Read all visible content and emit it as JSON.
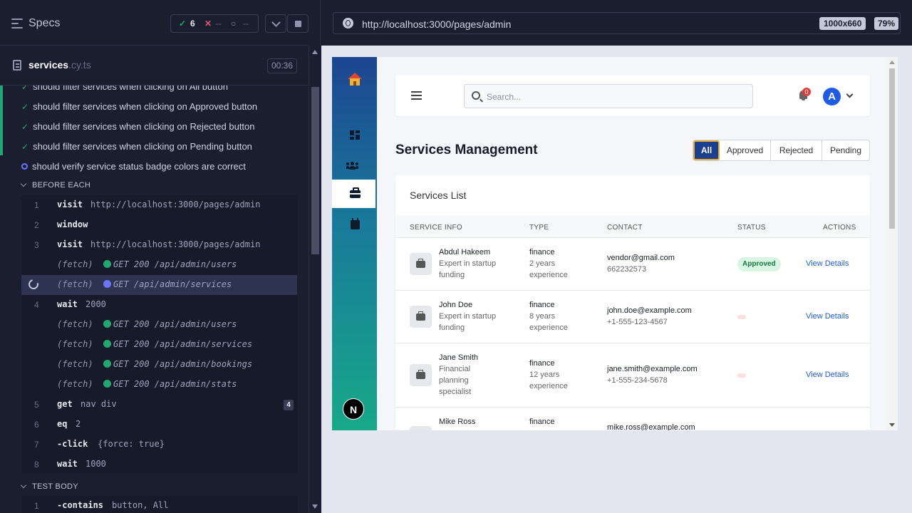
{
  "reporter": {
    "specs_label": "Specs",
    "stats": {
      "passed": "6",
      "failed": "--",
      "pending": "--"
    },
    "spec": {
      "name": "services",
      "ext": ".cy.ts",
      "duration": "00:36"
    },
    "tests": [
      {
        "title": "should filter services when clicking on All button",
        "state": "passed"
      },
      {
        "title": "should filter services when clicking on Approved button",
        "state": "passed"
      },
      {
        "title": "should filter services when clicking on Rejected button",
        "state": "passed"
      },
      {
        "title": "should filter services when clicking on Pending button",
        "state": "passed"
      },
      {
        "title": "should verify service status badge colors are correct",
        "state": "running"
      }
    ],
    "before_each_label": "BEFORE EACH",
    "before_each": [
      {
        "num": "1",
        "name": "visit",
        "msg": "http://localhost:3000/pages/admin"
      },
      {
        "num": "2",
        "name": "window",
        "msg": ""
      },
      {
        "num": "3",
        "name": "visit",
        "msg": "http://localhost:3000/pages/admin"
      },
      {
        "num": "",
        "name": "(fetch)",
        "msg": "GET 200 /api/admin/users"
      },
      {
        "num": "",
        "name": "(fetch)",
        "msg": "GET /api/admin/services"
      },
      {
        "num": "4",
        "name": "wait",
        "msg": "2000"
      },
      {
        "num": "",
        "name": "(fetch)",
        "msg": "GET 200 /api/admin/users"
      },
      {
        "num": "",
        "name": "(fetch)",
        "msg": "GET 200 /api/admin/services"
      },
      {
        "num": "",
        "name": "(fetch)",
        "msg": "GET 200 /api/admin/bookings"
      },
      {
        "num": "",
        "name": "(fetch)",
        "msg": "GET 200 /api/admin/stats"
      },
      {
        "num": "5",
        "name": "get",
        "msg": "nav div",
        "badge": "4"
      },
      {
        "num": "6",
        "name": "eq",
        "msg": "2"
      },
      {
        "num": "7",
        "name": "-click",
        "msg": "{force: true}"
      },
      {
        "num": "8",
        "name": "wait",
        "msg": "1000"
      }
    ],
    "test_body_label": "TEST BODY",
    "test_body": [
      {
        "num": "1",
        "name": "-contains",
        "msg": "button, All"
      }
    ]
  },
  "browser": {
    "url": "http://localhost:3000/pages/admin",
    "viewport": "1000x660",
    "zoom": "79%"
  },
  "app": {
    "logo_letter": "N",
    "search_placeholder": "Search...",
    "notification_count": "0",
    "avatar_letter": "A",
    "page_title": "Services Management",
    "filters": [
      "All",
      "Approved",
      "Rejected",
      "Pending"
    ],
    "active_filter": "All",
    "card_title": "Services List",
    "columns": [
      "SERVICE INFO",
      "TYPE",
      "CONTACT",
      "STATUS",
      "ACTIONS"
    ],
    "services": [
      {
        "name": "Abdul Hakeem",
        "desc": [
          "Expert in startup",
          "funding"
        ],
        "type": "finance",
        "experience": [
          "2 years",
          "experience"
        ],
        "email": "vendor@gmail.com",
        "phone": "662232573",
        "status": "Approved",
        "action": "View Details"
      },
      {
        "name": "John Doe",
        "desc": [
          "Expert in startup",
          "funding"
        ],
        "type": "finance",
        "experience": [
          "8 years",
          "experience"
        ],
        "email": "john.doe@example.com",
        "phone": "+1-555-123-4567",
        "status": "",
        "action": "View Details"
      },
      {
        "name": "Jane Smith",
        "desc": [
          "Financial",
          "planning",
          "specialist"
        ],
        "type": "finance",
        "experience": [
          "12 years",
          "experience"
        ],
        "email": "jane.smith@example.com",
        "phone": "+1-555-234-5678",
        "status": "",
        "action": "View Details"
      },
      {
        "name": "Mike Ross",
        "desc": [],
        "type": "finance",
        "experience": [],
        "email": "mike.ross@example.com",
        "phone": "",
        "status": "",
        "action": ""
      }
    ]
  }
}
